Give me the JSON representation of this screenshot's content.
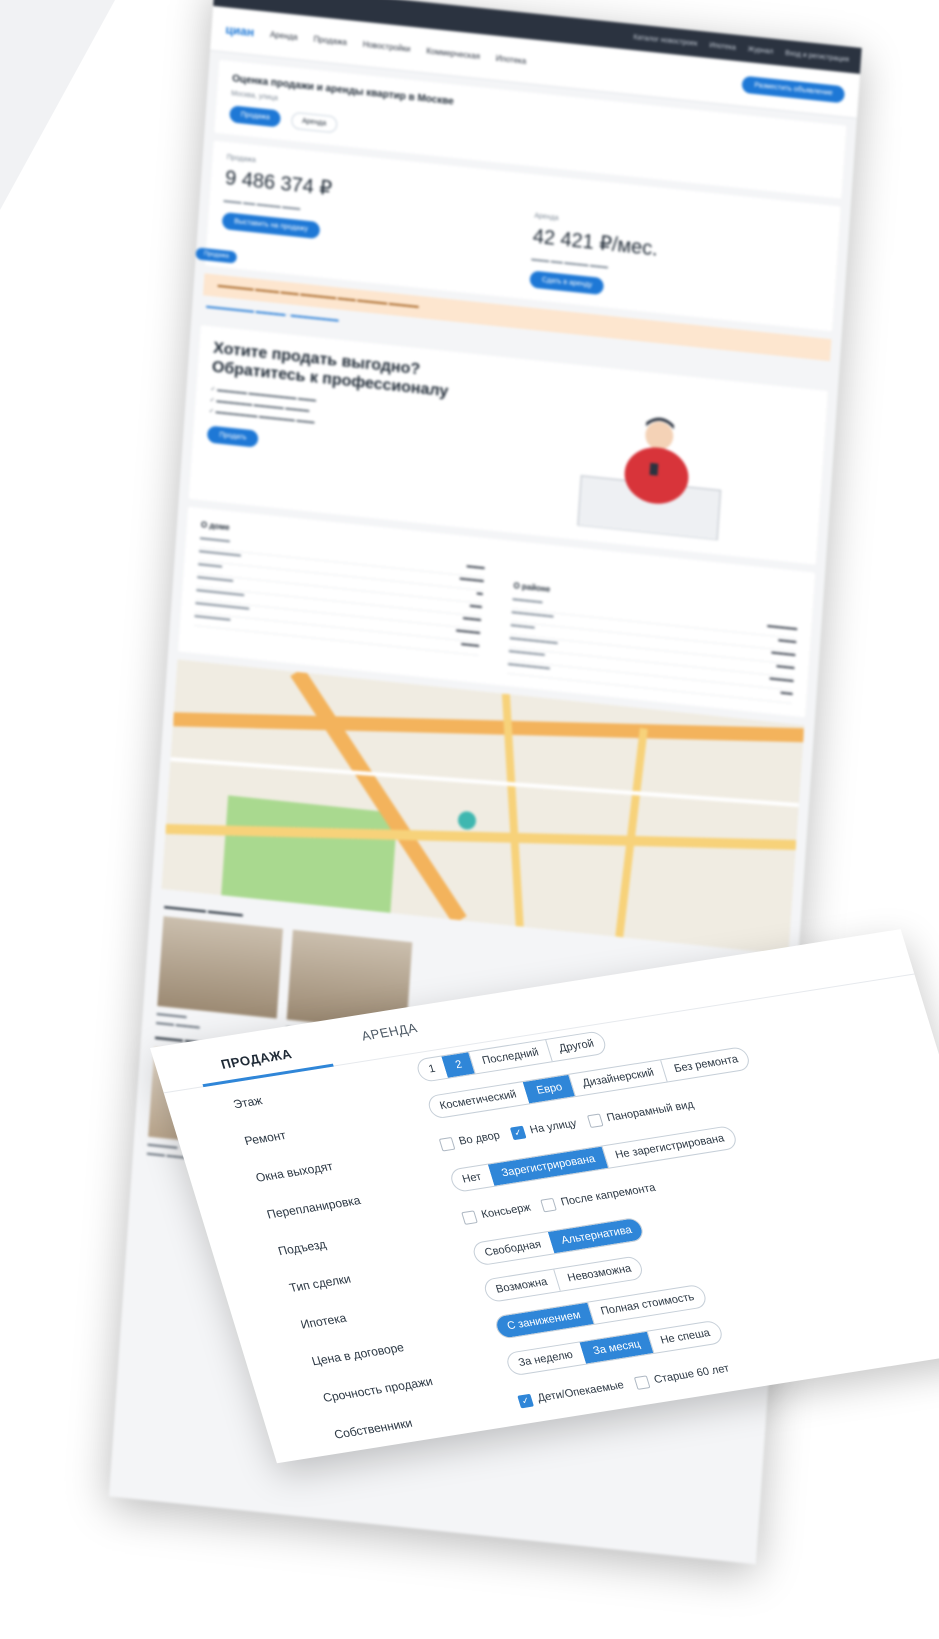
{
  "back_page": {
    "topbar_items": [
      "Каталог новостроек",
      "Ипотека",
      "Журнал",
      "Вход и регистрация"
    ],
    "nav": {
      "logo": "циан",
      "items": [
        "Аренда",
        "Продажа",
        "Новостройки",
        "Коммерческая",
        "Ипотека"
      ],
      "add_button": "Разместить объявление"
    },
    "eval": {
      "title": "Оценка продажи и аренды квартир в Москве",
      "subtitle": "Москва, улица",
      "tabs": [
        "Продажа",
        "Аренда"
      ]
    },
    "sale": {
      "label": "Продажа",
      "price": "9 486 374 ₽",
      "button": "Выставить на продажу"
    },
    "rent": {
      "label": "Аренда",
      "price": "42 421 ₽/мес.",
      "button": "Сдать в аренду"
    },
    "badge": "Продажа",
    "promo": {
      "title": "Хотите продать выгодно? Обратитесь к профессионалу",
      "button": "Продать"
    },
    "house_title": "О доме",
    "district_title": "О районе"
  },
  "filter": {
    "tabs": {
      "sale": "ПРОДАЖА",
      "rent": "АРЕНДА"
    },
    "labels": [
      "Этаж",
      "Ремонт",
      "Окна выходят",
      "Перепланировка",
      "Подъезд",
      "Тип сделки",
      "Ипотека",
      "Цена в договоре",
      "Срочность продажи",
      "Собственники"
    ],
    "floor": {
      "options": [
        "1",
        "2",
        "Последний",
        "Другой"
      ],
      "selected": "2"
    },
    "repair": {
      "options": [
        "Косметический",
        "Евро",
        "Дизайнерский",
        "Без ремонта"
      ],
      "selected": "Евро"
    },
    "windows": [
      {
        "label": "Во двор",
        "checked": false
      },
      {
        "label": "На улицу",
        "checked": true
      },
      {
        "label": "Панорамный вид",
        "checked": false
      }
    ],
    "replanning": {
      "options": [
        "Нет",
        "Зарегистрирована",
        "Не зарегистрирована"
      ],
      "selected": "Зарегистрирована"
    },
    "entrance": [
      {
        "label": "Консьерж",
        "checked": false
      },
      {
        "label": "После капремонта",
        "checked": false
      }
    ],
    "deal_type": {
      "options": [
        "Свободная",
        "Альтернатива"
      ],
      "selected": "Альтернатива"
    },
    "mortgage": {
      "options": [
        "Возможна",
        "Невозможна"
      ],
      "selected": ""
    },
    "contract_price": {
      "options": [
        "С занижением",
        "Полная стоимость"
      ],
      "selected": "С занижением"
    },
    "urgency": {
      "options": [
        "За неделю",
        "За месяц",
        "Не спеша"
      ],
      "selected": "За месяц"
    },
    "owners": [
      {
        "label": "Дети/Опекаемые",
        "checked": true
      },
      {
        "label": "Старше 60 лет",
        "checked": false
      }
    ],
    "accent_color": "#2f86d8"
  }
}
